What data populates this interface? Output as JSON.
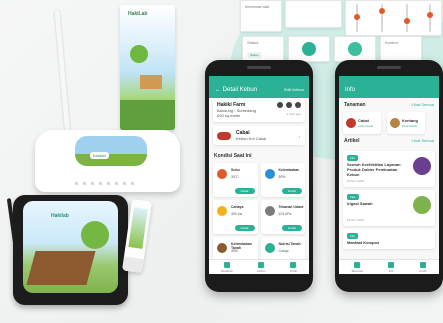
{
  "colors": {
    "accent": "#2bb196",
    "alert": "#c0392b"
  },
  "top_widgets": {
    "panel_a": "Informasi alat",
    "panel_b": "Status",
    "slider_label": "Kontrol"
  },
  "router": {
    "logo": "hakilab"
  },
  "banner": {
    "title": "HakiLab"
  },
  "box": {
    "title": "Hakilab"
  },
  "phone1": {
    "appbar_title": "Detail Kebun",
    "appbar_right": "Edit Kebun",
    "farm_name": "Hakiki Farm",
    "farm_location": "Bandung - Sumedang",
    "farm_extra": "600 sq meter",
    "farm_time": "3 mins ago",
    "crop_name": "Cabai",
    "crop_sub": "Kebun Kol Cabai",
    "section_title": "Kondisi Saat Ini",
    "sensors": [
      {
        "title": "Suhu",
        "value": "30°C",
        "btn": "Detail",
        "icon": "thermometer-icon",
        "color": "#e05a2c"
      },
      {
        "title": "Kelembaban",
        "value": "60%",
        "btn": "Detail",
        "icon": "humidity-icon",
        "color": "#2b8fd8"
      },
      {
        "title": "Cahaya",
        "value": "300 lux",
        "btn": "Detail",
        "icon": "sun-icon",
        "color": "#f2b21c"
      },
      {
        "title": "Tekanan Udara",
        "value": "101 kPa",
        "btn": "Detail",
        "icon": "pressure-icon",
        "color": "#7b7b7b"
      },
      {
        "title": "Kelembaban Tanah",
        "value": "45%",
        "btn": "Detail",
        "icon": "soil-icon",
        "color": "#8c5a2e"
      },
      {
        "title": "Nutrisi Tanah",
        "value": "Cukup",
        "btn": "Detail",
        "icon": "leaf-icon",
        "color": "#2bb196"
      }
    ],
    "nav": [
      "Beranda",
      "Kebun",
      "Profil"
    ]
  },
  "phone2": {
    "appbar_title": "Info",
    "tanaman_title": "Tanaman",
    "tanaman_link": "Lihat Semua",
    "tanaman": [
      {
        "name": "Cabai",
        "sub": "Lihat Detail"
      },
      {
        "name": "Kentang",
        "sub": "Lihat Detail"
      }
    ],
    "artikel_title": "Artikel",
    "artikel_link": "Lihat Semua",
    "artikel": [
      {
        "tag": "Info",
        "title": "Sentuh Keefektifan Layanan Produk Dokter Pembuatan Kebun",
        "date": "20 Nov 2020"
      },
      {
        "tag": "Tips",
        "title": "Irigasi Sawah",
        "date": "18 Nov 2020"
      },
      {
        "tag": "Info",
        "title": "Manfaat Kompos",
        "date": "15 Nov 2020"
      }
    ],
    "nav": [
      "Beranda",
      "Info",
      "Profil"
    ]
  }
}
